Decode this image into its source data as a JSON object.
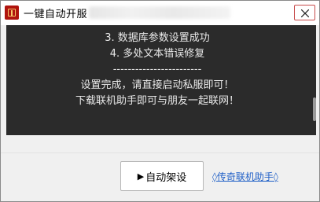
{
  "window": {
    "title": "一键自动开服",
    "close_icon": "close-icon"
  },
  "console": {
    "lines": [
      "3. 数据库参数设置成功",
      "4. 多处文本错误修复",
      "------------------------",
      "设置完成，请直接启动私服即可！",
      "下载联机助手即可与朋友一起联网！"
    ]
  },
  "actions": {
    "start_icon": "▶",
    "start_label": "自动架设",
    "helper_link": "◊传奇联机助手◊"
  }
}
